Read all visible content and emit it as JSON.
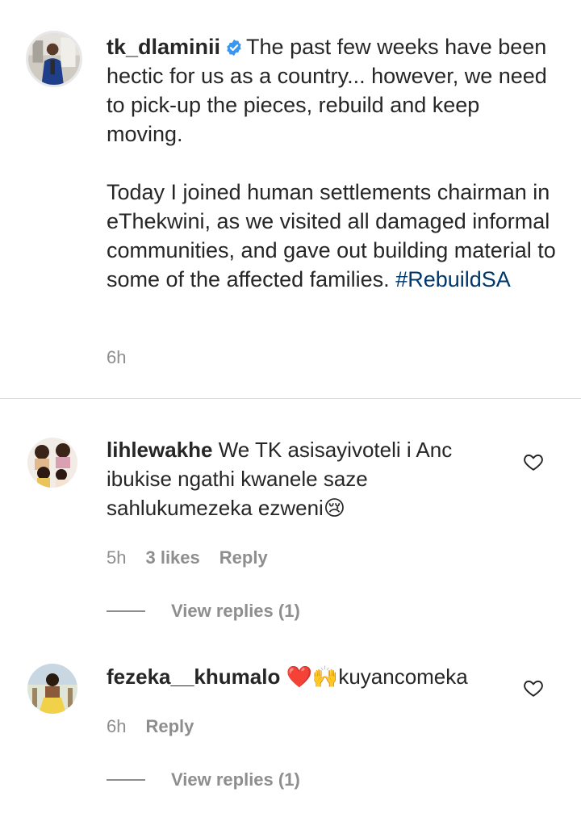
{
  "post": {
    "username": "tk_dlaminii",
    "para1": "The past few weeks have been hectic for us as a country... however, we need to pick-up the pieces, rebuild and keep moving.",
    "para2": "Today I joined human settlements chairman in eThekwini, as we visited all damaged informal communities, and gave out building material to some of the affected families.",
    "hashtag": "#RebuildSA",
    "time": "6h"
  },
  "comments": [
    {
      "username": "lihlewakhe",
      "text": "We TK asisayivoteli i Anc ibukise ngathi kwanele saze sahlukumezeka ezweni",
      "emoji": "😢",
      "time": "5h",
      "likes": "3 likes",
      "reply_label": "Reply",
      "view_replies": "View replies (1)"
    },
    {
      "username": "fezeka__khumalo",
      "emoji": "❤️🙌",
      "text": "kuyancomeka",
      "time": "6h",
      "reply_label": "Reply",
      "view_replies": "View replies (1)"
    }
  ],
  "colors": {
    "text": "#262626",
    "secondary": "#8e8e8e",
    "hashtag": "#00376b",
    "verified": "#3897f0",
    "divider": "#dbdbdb"
  },
  "icons": {
    "verified": "verified-badge-icon",
    "like": "heart-outline-icon"
  }
}
